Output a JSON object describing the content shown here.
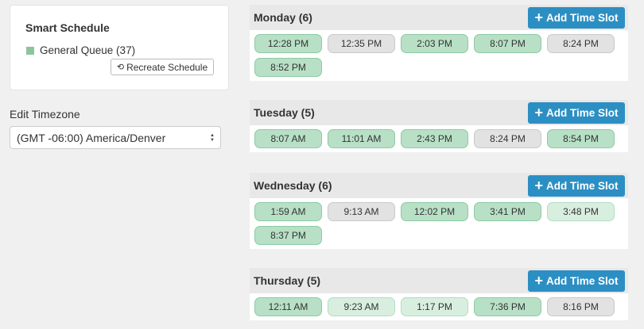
{
  "smart_schedule": {
    "title": "Smart Schedule",
    "queue_label": "General Queue (37)",
    "queue_color": "#8cc59c",
    "recreate_label": "Recreate Schedule"
  },
  "timezone": {
    "label": "Edit Timezone",
    "selected": "(GMT -06:00) America/Denver"
  },
  "add_slot_label": "Add Time Slot",
  "days": [
    {
      "title": "Monday (6)",
      "slots": [
        {
          "time": "12:28 PM",
          "state": "green"
        },
        {
          "time": "12:35 PM",
          "state": "gray"
        },
        {
          "time": "2:03 PM",
          "state": "green"
        },
        {
          "time": "8:07 PM",
          "state": "green"
        },
        {
          "time": "8:24 PM",
          "state": "gray"
        },
        {
          "time": "8:52 PM",
          "state": "green"
        }
      ]
    },
    {
      "title": "Tuesday (5)",
      "slots": [
        {
          "time": "8:07 AM",
          "state": "green"
        },
        {
          "time": "11:01 AM",
          "state": "green"
        },
        {
          "time": "2:43 PM",
          "state": "green"
        },
        {
          "time": "8:24 PM",
          "state": "gray"
        },
        {
          "time": "8:54 PM",
          "state": "green"
        }
      ]
    },
    {
      "title": "Wednesday (6)",
      "slots": [
        {
          "time": "1:59 AM",
          "state": "green"
        },
        {
          "time": "9:13 AM",
          "state": "gray"
        },
        {
          "time": "12:02 PM",
          "state": "green"
        },
        {
          "time": "3:41 PM",
          "state": "green"
        },
        {
          "time": "3:48 PM",
          "state": "light"
        },
        {
          "time": "8:37 PM",
          "state": "green"
        }
      ]
    },
    {
      "title": "Thursday (5)",
      "slots": [
        {
          "time": "12:11 AM",
          "state": "green"
        },
        {
          "time": "9:23 AM",
          "state": "light"
        },
        {
          "time": "1:17 PM",
          "state": "light"
        },
        {
          "time": "7:36 PM",
          "state": "green"
        },
        {
          "time": "8:16 PM",
          "state": "gray"
        }
      ]
    }
  ]
}
